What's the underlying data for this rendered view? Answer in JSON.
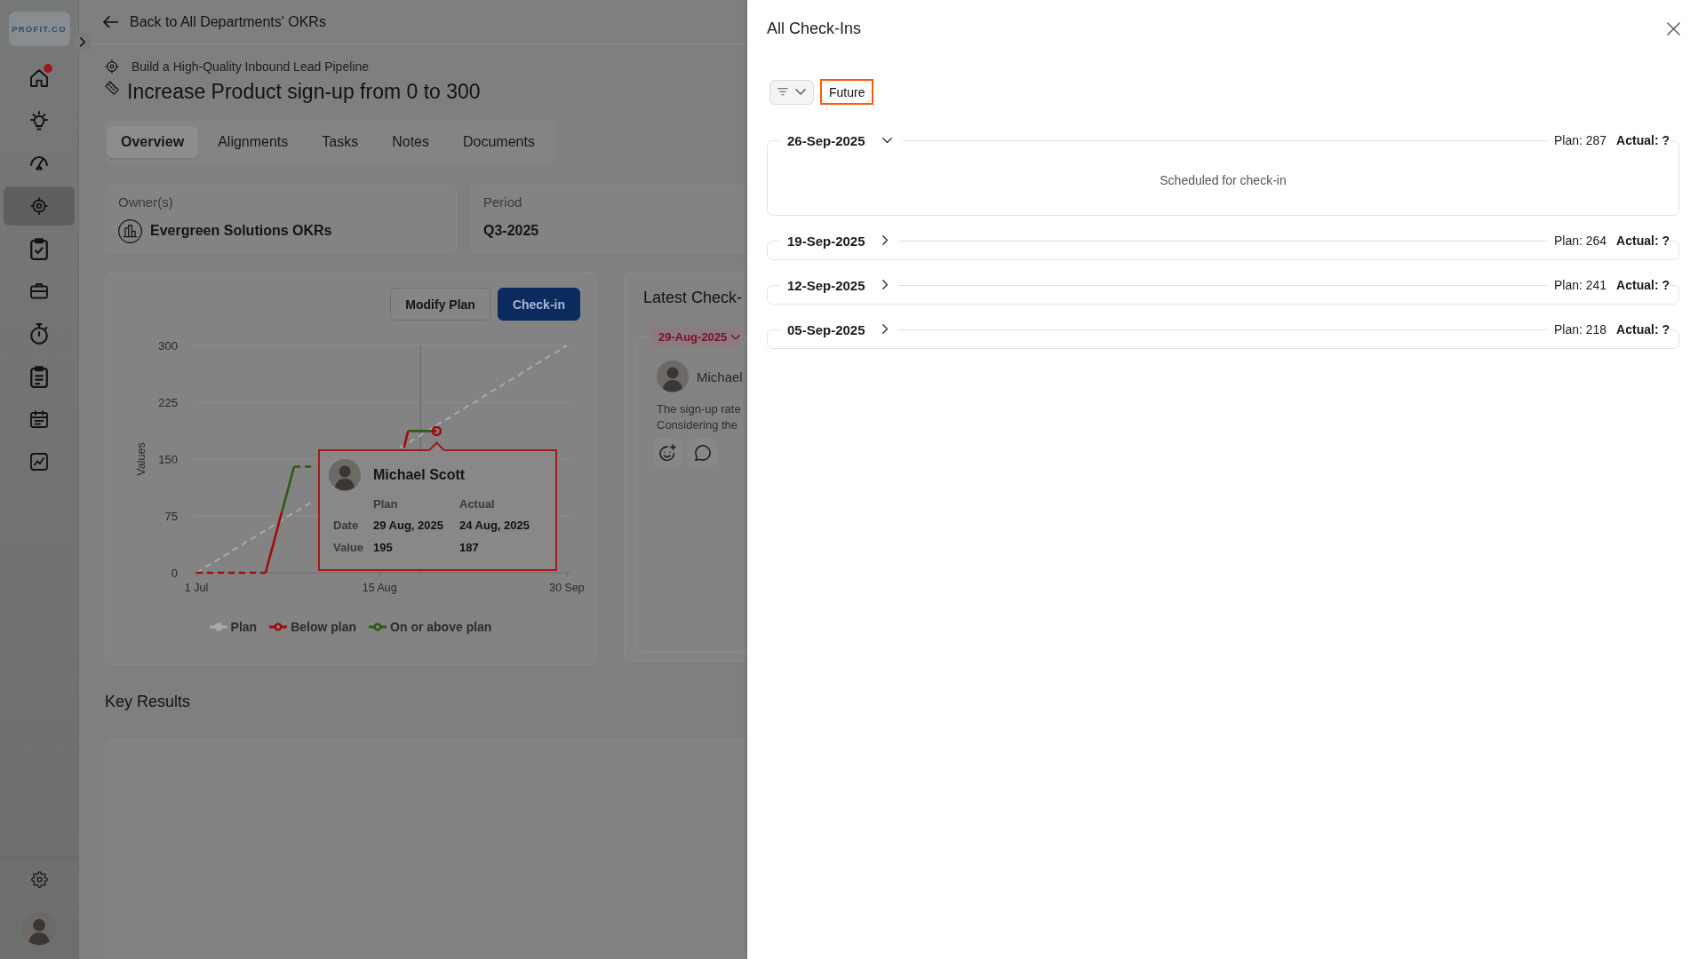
{
  "sidebar": {
    "logo": "PROFIT.CO",
    "items": [
      {
        "kind": "house",
        "selected": false,
        "badge": true
      },
      {
        "kind": "bulb",
        "selected": false,
        "badge": false
      },
      {
        "kind": "gauge",
        "selected": false,
        "badge": false
      },
      {
        "kind": "target",
        "selected": true,
        "badge": false
      },
      {
        "kind": "clipboard",
        "selected": false,
        "badge": false
      },
      {
        "kind": "briefcase",
        "selected": false,
        "badge": false
      },
      {
        "kind": "stopwatch",
        "selected": false,
        "badge": false
      },
      {
        "kind": "notepad",
        "selected": false,
        "badge": false
      },
      {
        "kind": "calendar",
        "selected": false,
        "badge": false
      },
      {
        "kind": "chart",
        "selected": false,
        "badge": false
      }
    ]
  },
  "header": {
    "back_link": "Back to All Departments' OKRs"
  },
  "objective": {
    "parent": "Build a High-Quality Inbound Lead Pipeline",
    "title": "Increase Product sign-up from 0 to 300"
  },
  "tabs": [
    {
      "label": "Overview",
      "selected": true
    },
    {
      "label": "Alignments",
      "selected": false
    },
    {
      "label": "Tasks",
      "selected": false
    },
    {
      "label": "Notes",
      "selected": false
    },
    {
      "label": "Documents",
      "selected": false
    }
  ],
  "details": [
    {
      "kind": "owner",
      "label": "Owner(s)",
      "value": "Evergreen Solutions OKRs"
    },
    {
      "kind": "period",
      "label": "Period",
      "value": "Q3-2025"
    }
  ],
  "progress_card": {
    "buttons": [
      {
        "label": "Modify Plan",
        "kind": "secondary"
      },
      {
        "label": "Check-in",
        "kind": "primary"
      }
    ],
    "chart_data": {
      "type": "line",
      "ylabel": "Values",
      "ylim": [
        0,
        300
      ],
      "yticks": [
        0,
        75,
        150,
        225,
        300
      ],
      "categories": [
        "1 Jul",
        null,
        null,
        null,
        null,
        null,
        null,
        null,
        null,
        null,
        null,
        null,
        null,
        null,
        null,
        null,
        null,
        null,
        null,
        null,
        null,
        null,
        null,
        null,
        null,
        null,
        null,
        null,
        null,
        null,
        null,
        null,
        null,
        null,
        null,
        null,
        null,
        null,
        null,
        null,
        null,
        null,
        null,
        null,
        null,
        "15 Aug",
        null,
        null,
        null,
        null,
        null,
        null,
        null,
        null,
        null,
        null,
        null,
        null,
        null,
        null,
        null,
        null,
        null,
        null,
        null,
        null,
        null,
        null,
        null,
        null,
        null,
        null,
        null,
        null,
        null,
        null,
        null,
        null,
        null,
        null,
        null,
        null,
        null,
        null,
        null,
        null,
        null,
        null,
        null,
        null,
        null,
        "30 Sep"
      ],
      "series": [
        {
          "name": "Plan",
          "color": "#a9a9a9",
          "line_style": "dashed",
          "values": [
            0,
            3,
            7,
            10,
            13,
            16,
            20,
            23,
            26,
            30,
            33,
            36,
            40,
            43,
            46,
            49,
            53,
            56,
            59,
            63,
            66,
            69,
            73,
            76,
            79,
            82,
            86,
            89,
            92,
            96,
            null,
            null,
            null,
            null,
            null,
            null,
            null,
            null,
            null,
            null,
            null,
            null,
            null,
            null,
            null,
            null,
            null,
            null,
            null,
            null,
            165,
            168,
            171,
            175,
            178,
            181,
            185,
            188,
            191,
            195,
            198,
            201,
            204,
            208,
            211,
            214,
            218,
            221,
            224,
            227,
            231,
            234,
            237,
            241,
            244,
            247,
            251,
            254,
            257,
            260,
            264,
            267,
            270,
            274,
            277,
            280,
            284,
            287,
            290,
            293,
            297,
            300
          ]
        },
        {
          "name": "Below plan",
          "color": "#9c0d0d",
          "values": [
            0,
            0,
            0,
            0,
            0,
            0,
            0,
            0,
            0,
            0,
            0,
            0,
            0,
            0,
            0,
            0,
            0,
            0,
            20,
            40,
            60,
            80,
            null,
            null,
            null,
            null,
            null,
            null,
            null,
            null,
            null,
            null,
            null,
            null,
            null,
            null,
            null,
            null,
            null,
            null,
            null,
            null,
            null,
            null,
            null,
            null,
            null,
            null,
            null,
            null,
            null,
            165,
            187,
            null,
            null,
            null,
            null,
            null,
            187,
            187,
            null,
            null,
            null,
            null,
            null,
            null,
            null,
            null,
            null,
            null,
            null,
            null,
            null,
            null,
            null,
            null,
            null,
            null,
            null,
            null,
            null,
            null,
            null,
            null,
            null,
            null,
            null,
            null,
            null,
            null,
            null,
            null
          ]
        },
        {
          "name": "On or above plan",
          "color": "#2b5c18",
          "values": [
            null,
            null,
            null,
            null,
            null,
            null,
            null,
            null,
            null,
            null,
            null,
            null,
            null,
            null,
            null,
            null,
            null,
            null,
            null,
            null,
            null,
            80,
            100,
            120,
            140,
            140,
            140,
            140,
            140,
            140,
            null,
            null,
            null,
            null,
            null,
            null,
            null,
            null,
            null,
            null,
            null,
            null,
            null,
            null,
            null,
            null,
            null,
            null,
            null,
            null,
            null,
            null,
            187,
            187,
            187,
            187,
            187,
            187,
            187,
            null,
            null,
            null,
            null,
            null,
            null,
            null,
            null,
            null,
            null,
            null,
            null,
            null,
            null,
            null,
            null,
            null,
            null,
            null,
            null,
            null,
            null,
            null,
            null,
            null,
            null,
            null,
            null,
            null,
            null,
            null,
            null,
            null
          ]
        }
      ]
    },
    "tooltip": {
      "name": "Michael Scott",
      "columns": [
        "Plan",
        "Actual"
      ],
      "rows": [
        {
          "label": "Date",
          "values": [
            "29 Aug, 2025",
            "24 Aug, 2025"
          ]
        },
        {
          "label": "Value",
          "values": [
            "195",
            "187"
          ]
        }
      ]
    }
  },
  "latest_checkin": {
    "title": "Latest Check-",
    "date": "29-Aug-2025",
    "author": "Michael",
    "comment_lines": [
      "The sign-up rate",
      "Considering the"
    ]
  },
  "key_results": {
    "title": "Key Results"
  },
  "drawer": {
    "title": "All Check-Ins",
    "filter": "Future",
    "checkins": [
      {
        "date": "26-Sep-2025",
        "expanded": true,
        "plan": "Plan: 287",
        "actual": "Actual: ?",
        "body": "Scheduled for check-in"
      },
      {
        "date": "19-Sep-2025",
        "expanded": false,
        "plan": "Plan: 264",
        "actual": "Actual: ?"
      },
      {
        "date": "12-Sep-2025",
        "expanded": false,
        "plan": "Plan: 241",
        "actual": "Actual: ?"
      },
      {
        "date": "05-Sep-2025",
        "expanded": false,
        "plan": "Plan: 218",
        "actual": "Actual: ?"
      }
    ]
  }
}
